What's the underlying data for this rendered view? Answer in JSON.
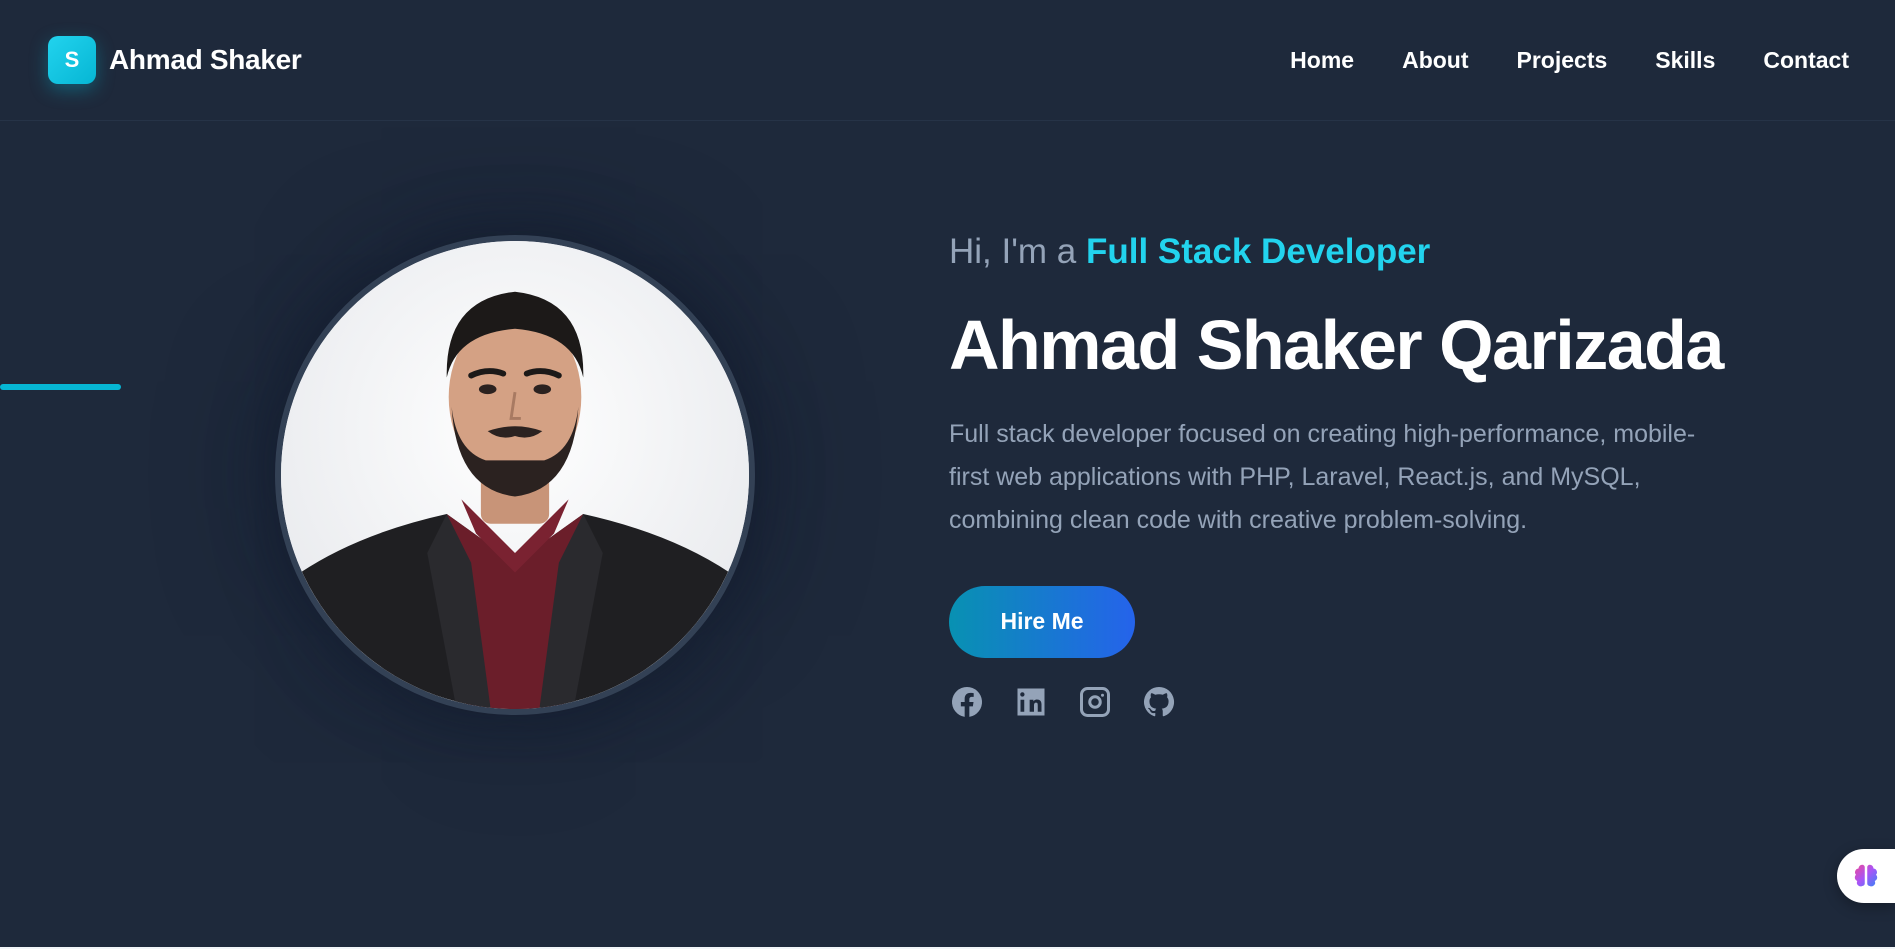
{
  "header": {
    "logo_letter": "S",
    "brand_name": "Ahmad Shaker",
    "nav": [
      {
        "label": "Home"
      },
      {
        "label": "About"
      },
      {
        "label": "Projects"
      },
      {
        "label": "Skills"
      },
      {
        "label": "Contact"
      }
    ]
  },
  "hero": {
    "greeting_prefix": "Hi, I'm a",
    "role": "Full Stack Developer",
    "name": "Ahmad Shaker Qarizada",
    "bio": "Full stack developer focused on creating high-performance, mobile-first web applications with PHP, Laravel, React.js, and MySQL, combining clean code with creative problem-solving.",
    "cta_label": "Hire Me",
    "socials": [
      {
        "icon": "facebook-icon"
      },
      {
        "icon": "linkedin-icon"
      },
      {
        "icon": "instagram-icon"
      },
      {
        "icon": "github-icon"
      }
    ]
  },
  "colors": {
    "background": "#1e293b",
    "accent": "#22d3ee",
    "muted_text": "#94a3b8",
    "button_gradient_start": "#0891b2",
    "button_gradient_end": "#2563eb"
  },
  "widget": {
    "icon": "brain-icon"
  }
}
